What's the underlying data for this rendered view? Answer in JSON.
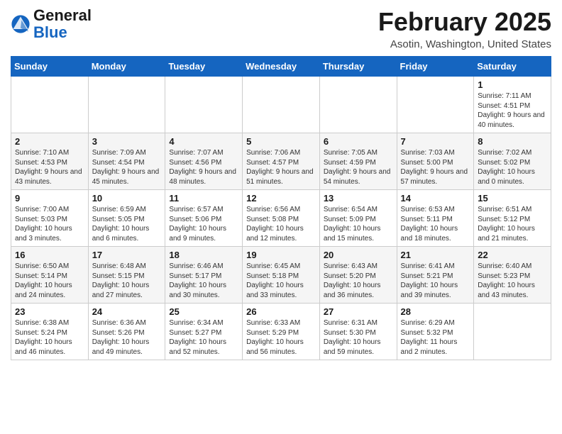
{
  "logo": {
    "general": "General",
    "blue": "Blue"
  },
  "title": "February 2025",
  "location": "Asotin, Washington, United States",
  "weekdays": [
    "Sunday",
    "Monday",
    "Tuesday",
    "Wednesday",
    "Thursday",
    "Friday",
    "Saturday"
  ],
  "weeks": [
    [
      {
        "num": "",
        "info": ""
      },
      {
        "num": "",
        "info": ""
      },
      {
        "num": "",
        "info": ""
      },
      {
        "num": "",
        "info": ""
      },
      {
        "num": "",
        "info": ""
      },
      {
        "num": "",
        "info": ""
      },
      {
        "num": "1",
        "info": "Sunrise: 7:11 AM\nSunset: 4:51 PM\nDaylight: 9 hours and 40 minutes."
      }
    ],
    [
      {
        "num": "2",
        "info": "Sunrise: 7:10 AM\nSunset: 4:53 PM\nDaylight: 9 hours and 43 minutes."
      },
      {
        "num": "3",
        "info": "Sunrise: 7:09 AM\nSunset: 4:54 PM\nDaylight: 9 hours and 45 minutes."
      },
      {
        "num": "4",
        "info": "Sunrise: 7:07 AM\nSunset: 4:56 PM\nDaylight: 9 hours and 48 minutes."
      },
      {
        "num": "5",
        "info": "Sunrise: 7:06 AM\nSunset: 4:57 PM\nDaylight: 9 hours and 51 minutes."
      },
      {
        "num": "6",
        "info": "Sunrise: 7:05 AM\nSunset: 4:59 PM\nDaylight: 9 hours and 54 minutes."
      },
      {
        "num": "7",
        "info": "Sunrise: 7:03 AM\nSunset: 5:00 PM\nDaylight: 9 hours and 57 minutes."
      },
      {
        "num": "8",
        "info": "Sunrise: 7:02 AM\nSunset: 5:02 PM\nDaylight: 10 hours and 0 minutes."
      }
    ],
    [
      {
        "num": "9",
        "info": "Sunrise: 7:00 AM\nSunset: 5:03 PM\nDaylight: 10 hours and 3 minutes."
      },
      {
        "num": "10",
        "info": "Sunrise: 6:59 AM\nSunset: 5:05 PM\nDaylight: 10 hours and 6 minutes."
      },
      {
        "num": "11",
        "info": "Sunrise: 6:57 AM\nSunset: 5:06 PM\nDaylight: 10 hours and 9 minutes."
      },
      {
        "num": "12",
        "info": "Sunrise: 6:56 AM\nSunset: 5:08 PM\nDaylight: 10 hours and 12 minutes."
      },
      {
        "num": "13",
        "info": "Sunrise: 6:54 AM\nSunset: 5:09 PM\nDaylight: 10 hours and 15 minutes."
      },
      {
        "num": "14",
        "info": "Sunrise: 6:53 AM\nSunset: 5:11 PM\nDaylight: 10 hours and 18 minutes."
      },
      {
        "num": "15",
        "info": "Sunrise: 6:51 AM\nSunset: 5:12 PM\nDaylight: 10 hours and 21 minutes."
      }
    ],
    [
      {
        "num": "16",
        "info": "Sunrise: 6:50 AM\nSunset: 5:14 PM\nDaylight: 10 hours and 24 minutes."
      },
      {
        "num": "17",
        "info": "Sunrise: 6:48 AM\nSunset: 5:15 PM\nDaylight: 10 hours and 27 minutes."
      },
      {
        "num": "18",
        "info": "Sunrise: 6:46 AM\nSunset: 5:17 PM\nDaylight: 10 hours and 30 minutes."
      },
      {
        "num": "19",
        "info": "Sunrise: 6:45 AM\nSunset: 5:18 PM\nDaylight: 10 hours and 33 minutes."
      },
      {
        "num": "20",
        "info": "Sunrise: 6:43 AM\nSunset: 5:20 PM\nDaylight: 10 hours and 36 minutes."
      },
      {
        "num": "21",
        "info": "Sunrise: 6:41 AM\nSunset: 5:21 PM\nDaylight: 10 hours and 39 minutes."
      },
      {
        "num": "22",
        "info": "Sunrise: 6:40 AM\nSunset: 5:23 PM\nDaylight: 10 hours and 43 minutes."
      }
    ],
    [
      {
        "num": "23",
        "info": "Sunrise: 6:38 AM\nSunset: 5:24 PM\nDaylight: 10 hours and 46 minutes."
      },
      {
        "num": "24",
        "info": "Sunrise: 6:36 AM\nSunset: 5:26 PM\nDaylight: 10 hours and 49 minutes."
      },
      {
        "num": "25",
        "info": "Sunrise: 6:34 AM\nSunset: 5:27 PM\nDaylight: 10 hours and 52 minutes."
      },
      {
        "num": "26",
        "info": "Sunrise: 6:33 AM\nSunset: 5:29 PM\nDaylight: 10 hours and 56 minutes."
      },
      {
        "num": "27",
        "info": "Sunrise: 6:31 AM\nSunset: 5:30 PM\nDaylight: 10 hours and 59 minutes."
      },
      {
        "num": "28",
        "info": "Sunrise: 6:29 AM\nSunset: 5:32 PM\nDaylight: 11 hours and 2 minutes."
      },
      {
        "num": "",
        "info": ""
      }
    ]
  ]
}
